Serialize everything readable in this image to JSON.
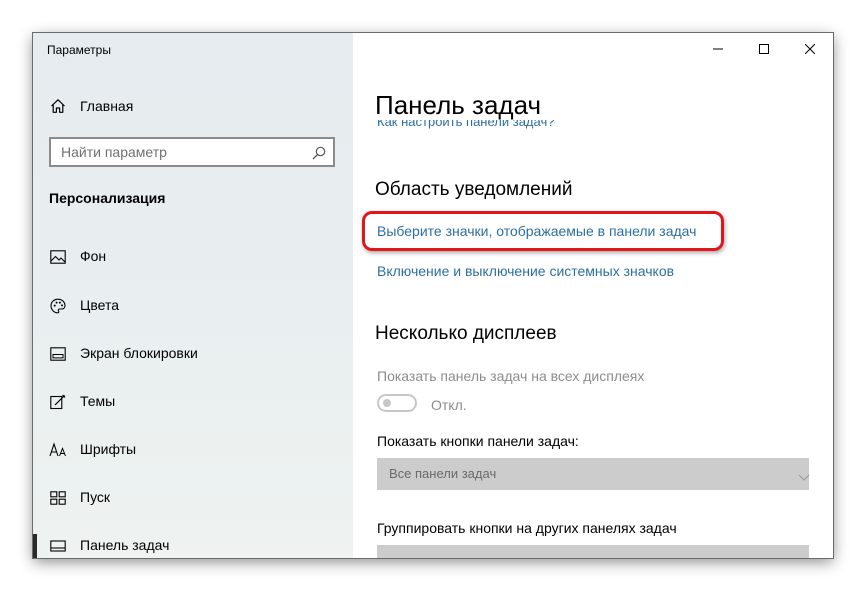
{
  "window": {
    "title": "Параметры"
  },
  "sidebar": {
    "home_label": "Главная",
    "search_placeholder": "Найти параметр",
    "section_title": "Персонализация",
    "items": [
      {
        "label": "Фон",
        "icon": "image-icon"
      },
      {
        "label": "Цвета",
        "icon": "palette-icon"
      },
      {
        "label": "Экран блокировки",
        "icon": "lock-screen-icon"
      },
      {
        "label": "Темы",
        "icon": "themes-icon"
      },
      {
        "label": "Шрифты",
        "icon": "fonts-icon"
      },
      {
        "label": "Пуск",
        "icon": "start-icon"
      },
      {
        "label": "Панель задач",
        "icon": "taskbar-icon",
        "active": true
      }
    ]
  },
  "content": {
    "title": "Панель задач",
    "partial_link": "Как настроить панели задач?",
    "notification_area": {
      "heading": "Область уведомлений",
      "link_select_icons": "Выберите значки, отображаемые в панели задач",
      "link_system_icons": "Включение и выключение системных значков"
    },
    "multiple_displays": {
      "heading": "Несколько дисплеев",
      "show_taskbar_label": "Показать панель задач на всех дисплеях",
      "toggle_state": "Откл.",
      "show_buttons_label": "Показать кнопки панели задач:",
      "show_buttons_value": "Все панели задач",
      "combine_label": "Группировать кнопки на других панелях задач"
    }
  },
  "colors": {
    "accent_link": "#2d6fa3",
    "highlight": "#e0161a",
    "sidebar_bg": "#e8eef0"
  }
}
